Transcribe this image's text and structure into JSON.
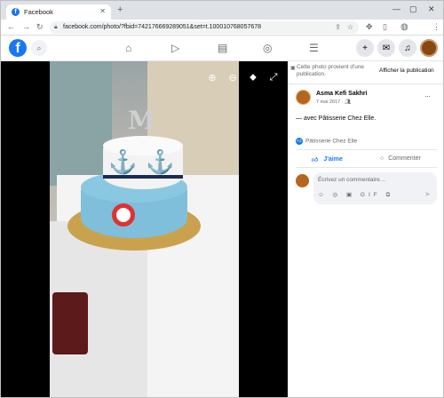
{
  "browser": {
    "tab_title": "Facebook",
    "favicon_letter": "f",
    "tab_close": "✕",
    "new_tab": "+",
    "url": "facebook.com/photo/?fbid=742176669289051&set=t.100010768057678",
    "window_controls": [
      "—",
      "▢",
      "✕"
    ],
    "icons": [
      "back-icon",
      "forward-icon",
      "reload-icon",
      "lock-icon",
      "share-icon",
      "star-icon",
      "extensions-icon",
      "sidebar-icon",
      "profile-icon",
      "menu-icon"
    ]
  },
  "fb_header": {
    "logo": "f",
    "nav_icons": [
      "home-icon",
      "watch-icon",
      "marketplace-icon",
      "groups-icon",
      "menu-icon"
    ],
    "right_buttons": [
      "create-icon",
      "messenger-icon",
      "notifications-icon"
    ]
  },
  "panel": {
    "notice": "Cette photo provient d'une publication.",
    "show_publication": "Afficher la publication",
    "author": "Asma Kefi Sakhri",
    "date": "7 mai 2017 · ",
    "more": "···",
    "post_text": "— avec Pâtisserie Chez Elle.",
    "liked_by": "Pâtisserie Chez Elle",
    "like_label": "J'aime",
    "comment_label": "Commenter",
    "comment_placeholder": "Écrivez un commentaire…",
    "comment_tools": [
      "☺",
      "◎",
      "▣",
      "GIF",
      "⧉"
    ],
    "send": "➤"
  },
  "colors": {
    "fb_blue": "#1877f2",
    "viewer_bg": "#000000"
  }
}
